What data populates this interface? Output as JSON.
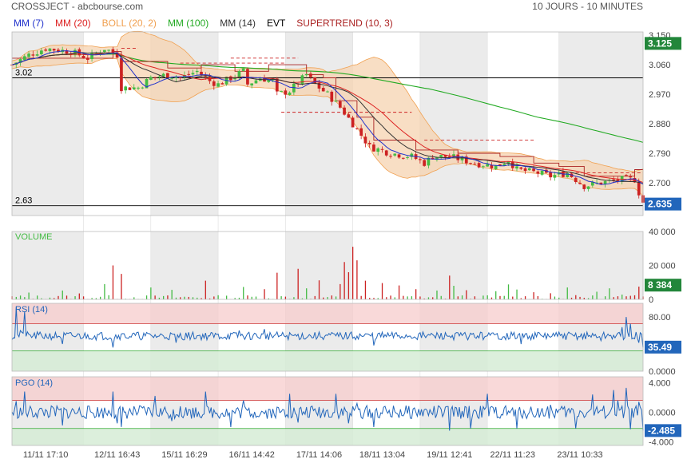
{
  "header": {
    "left": "CROSSJECT - abcbourse.com",
    "right": "10 JOURS - 10 MINUTES"
  },
  "legend": [
    {
      "label": "MM (7)",
      "color": "#2233cc"
    },
    {
      "label": "MM (20)",
      "color": "#dd2222"
    },
    {
      "label": "BOLL (20, 2)",
      "color": "#f0a050"
    },
    {
      "label": "MM (100)",
      "color": "#22aa22"
    },
    {
      "label": "MM (14)",
      "color": "#333333"
    },
    {
      "label": "EVT",
      "color": "#000000"
    },
    {
      "label": "SUPERTREND (10, 3)",
      "color": "#aa2222"
    }
  ],
  "colors": {
    "up": "#44bb44",
    "down": "#cc2222",
    "boll": "#f0a050",
    "ma100": "#22aa22",
    "ma7": "#2233cc",
    "ma20": "#dd2222",
    "ma14": "#333333",
    "supertrend": "#aa2222",
    "indicator": "#2266bb",
    "shade": "#ebebeb",
    "zoneHigh": "#f7cccc",
    "zoneLow": "#d6ecd6",
    "badgeUp": "#22863a",
    "badgeDown": "#2266bb"
  },
  "chart_data": [
    {
      "type": "candlestick",
      "name": "price",
      "ylim": [
        2.6,
        3.16
      ],
      "y_ticks": [
        3.15,
        3.06,
        2.97,
        2.88,
        2.79,
        2.7
      ],
      "y_tick_labels": [
        "3.150",
        "3.060",
        "2.970",
        "2.880",
        "2.790",
        "2.700"
      ],
      "hlines": [
        {
          "value": 3.02,
          "label": "3.02"
        },
        {
          "value": 2.63,
          "label": "2.63"
        }
      ],
      "badges": [
        {
          "value": 3.125,
          "label": "3.125",
          "color": "#22863a"
        },
        {
          "value": 2.635,
          "label": "2.635",
          "color": "#2266bb"
        }
      ],
      "path": [
        [
          0,
          3.06
        ],
        [
          4,
          3.09
        ],
        [
          8,
          3.11
        ],
        [
          14,
          3.1
        ],
        [
          18,
          3.08
        ],
        [
          22,
          3.11
        ],
        [
          25,
          3.09
        ],
        [
          26,
          2.99
        ],
        [
          30,
          2.99
        ],
        [
          33,
          3.02
        ],
        [
          37,
          3.03
        ],
        [
          40,
          3.02
        ],
        [
          44,
          3.04
        ],
        [
          47,
          3.01
        ],
        [
          49,
          3.0
        ],
        [
          52,
          3.02
        ],
        [
          55,
          3.04
        ],
        [
          56,
          3.0
        ],
        [
          59,
          3.02
        ],
        [
          62,
          3.01
        ],
        [
          63,
          2.97
        ],
        [
          66,
          2.98
        ],
        [
          70,
          3.03
        ],
        [
          72,
          3.0
        ],
        [
          75,
          2.97
        ],
        [
          78,
          2.93
        ],
        [
          81,
          2.88
        ],
        [
          85,
          2.81
        ],
        [
          90,
          2.79
        ],
        [
          95,
          2.78
        ],
        [
          98,
          2.76
        ],
        [
          100,
          2.78
        ],
        [
          104,
          2.78
        ],
        [
          107,
          2.77
        ],
        [
          110,
          2.76
        ],
        [
          115,
          2.75
        ],
        [
          118,
          2.77
        ],
        [
          120,
          2.74
        ],
        [
          125,
          2.73
        ],
        [
          128,
          2.72
        ],
        [
          132,
          2.73
        ],
        [
          136,
          2.69
        ],
        [
          140,
          2.7
        ],
        [
          145,
          2.71
        ],
        [
          148,
          2.71
        ],
        [
          149,
          2.67
        ],
        [
          150,
          2.64
        ]
      ],
      "supertrend": [
        [
          0,
          3.08
        ],
        [
          24,
          3.1
        ],
        [
          26,
          3.07
        ],
        [
          36,
          3.07
        ],
        [
          37,
          3.05
        ],
        [
          44,
          3.05
        ],
        [
          45,
          3.06
        ],
        [
          50,
          3.06
        ],
        [
          53,
          3.04
        ],
        [
          60,
          3.04
        ],
        [
          61,
          3.06
        ],
        [
          68,
          3.06
        ],
        [
          70,
          3.03
        ],
        [
          74,
          3.02
        ],
        [
          77,
          2.95
        ],
        [
          82,
          2.9
        ],
        [
          86,
          2.83
        ],
        [
          96,
          2.8
        ],
        [
          106,
          2.79
        ],
        [
          112,
          2.79
        ],
        [
          116,
          2.78
        ],
        [
          124,
          2.76
        ],
        [
          130,
          2.75
        ],
        [
          136,
          2.72
        ],
        [
          144,
          2.72
        ],
        [
          148,
          2.74
        ],
        [
          150,
          2.74
        ]
      ],
      "dashed_levels": [
        {
          "from": 26,
          "to": 30,
          "value": 3.11
        },
        {
          "from": 40,
          "to": 65,
          "value": 3.065
        },
        {
          "from": 52,
          "to": 68,
          "value": 3.08
        },
        {
          "from": 64,
          "to": 95,
          "value": 2.915
        },
        {
          "from": 98,
          "to": 124,
          "value": 2.83
        },
        {
          "from": 130,
          "to": 150,
          "value": 2.73
        }
      ]
    },
    {
      "type": "bar",
      "name": "VOLUME",
      "ylim": [
        0,
        40000
      ],
      "y_ticks": [
        40000,
        20000,
        0
      ],
      "y_tick_labels": [
        "40 000",
        "20 000",
        "0"
      ],
      "spikes": [
        [
          4,
          4000
        ],
        [
          12,
          5200
        ],
        [
          16,
          3500
        ],
        [
          22,
          9000
        ],
        [
          24,
          20000
        ],
        [
          26,
          15000
        ],
        [
          33,
          7000
        ],
        [
          38,
          5600
        ],
        [
          46,
          11000
        ],
        [
          55,
          7300
        ],
        [
          60,
          6000
        ],
        [
          63,
          15700
        ],
        [
          68,
          18000
        ],
        [
          70,
          6500
        ],
        [
          73,
          11200
        ],
        [
          78,
          9000
        ],
        [
          79,
          22000
        ],
        [
          80,
          16000
        ],
        [
          81,
          31000
        ],
        [
          82,
          23000
        ],
        [
          84,
          11000
        ],
        [
          88,
          9600
        ],
        [
          92,
          8200
        ],
        [
          96,
          6000
        ],
        [
          101,
          5200
        ],
        [
          104,
          14000
        ],
        [
          105,
          8000
        ],
        [
          108,
          5400
        ],
        [
          115,
          4800
        ],
        [
          118,
          8800
        ],
        [
          120,
          5800
        ],
        [
          124,
          4200
        ],
        [
          128,
          3600
        ],
        [
          132,
          7000
        ],
        [
          139,
          4500
        ],
        [
          142,
          6500
        ],
        [
          145,
          2800
        ],
        [
          149,
          7500
        ]
      ],
      "badge": {
        "value": 8384,
        "label": "8 384",
        "color": "#22863a"
      }
    },
    {
      "type": "line",
      "name": "RSI (14)",
      "ylim": [
        0,
        100
      ],
      "y_ticks": [
        80,
        0
      ],
      "y_tick_labels": [
        "80.00",
        "0.0000"
      ],
      "zones": {
        "high": 70,
        "low": 30
      },
      "spikes": [
        [
          1,
          95
        ],
        [
          2,
          60
        ],
        [
          3,
          88
        ],
        [
          12,
          40
        ],
        [
          24,
          35
        ],
        [
          26,
          55
        ],
        [
          39,
          42
        ],
        [
          54,
          60
        ],
        [
          60,
          62
        ],
        [
          77,
          52
        ],
        [
          86,
          38
        ],
        [
          113,
          52
        ],
        [
          121,
          40
        ],
        [
          140,
          45
        ],
        [
          145,
          65
        ],
        [
          146,
          80
        ],
        [
          147,
          70
        ],
        [
          149,
          42
        ],
        [
          150,
          35
        ]
      ],
      "badge": {
        "value": 35.49,
        "label": "35.49",
        "color": "#2266bb"
      }
    },
    {
      "type": "line",
      "name": "PGO (14)",
      "ylim": [
        -4.5,
        4.8
      ],
      "y_ticks": [
        4,
        0,
        -4
      ],
      "y_tick_labels": [
        "4.000",
        "0.0000",
        "-4.000"
      ],
      "zones": {
        "high": 1.6,
        "low": -2.2
      },
      "spikes": [
        [
          1,
          1.5
        ],
        [
          3,
          2.8
        ],
        [
          12,
          -1.8
        ],
        [
          24,
          2.8
        ],
        [
          25,
          -1.5
        ],
        [
          26,
          -2.0
        ],
        [
          34,
          2.2
        ],
        [
          38,
          -1.2
        ],
        [
          40,
          0.8
        ],
        [
          46,
          2.8
        ],
        [
          52,
          -2.0
        ],
        [
          55,
          1.6
        ],
        [
          66,
          2.5
        ],
        [
          68,
          -1.4
        ],
        [
          77,
          2.5
        ],
        [
          80,
          -1.5
        ],
        [
          82,
          1.2
        ],
        [
          86,
          -2.0
        ],
        [
          104,
          -2.5
        ],
        [
          109,
          -2.2
        ],
        [
          113,
          2.5
        ],
        [
          120,
          -2.2
        ],
        [
          128,
          1.0
        ],
        [
          134,
          -2.2
        ],
        [
          138,
          2.4
        ],
        [
          143,
          3.0
        ],
        [
          144,
          1.6
        ],
        [
          146,
          3.3
        ],
        [
          147,
          -2.3
        ],
        [
          149,
          1.4
        ],
        [
          150,
          -2.485
        ]
      ],
      "badge": {
        "value": -2.485,
        "label": "-2.485",
        "color": "#2266bb"
      }
    }
  ],
  "x_axis": {
    "labels": [
      "11/11 17:10",
      "12/11 16:43",
      "15/11 16:29",
      "16/11 14:42",
      "17/11 14:06",
      "18/11 13:04",
      "19/11 12:41",
      "22/11 11:23",
      "23/11 10:33"
    ],
    "label_positions": [
      8,
      25,
      41,
      57,
      73,
      88,
      104,
      119,
      135
    ],
    "day_starts": [
      0,
      17,
      33,
      49,
      65,
      81,
      97,
      113,
      130,
      150
    ],
    "shaded_days": [
      0,
      2,
      4,
      6,
      8
    ]
  }
}
